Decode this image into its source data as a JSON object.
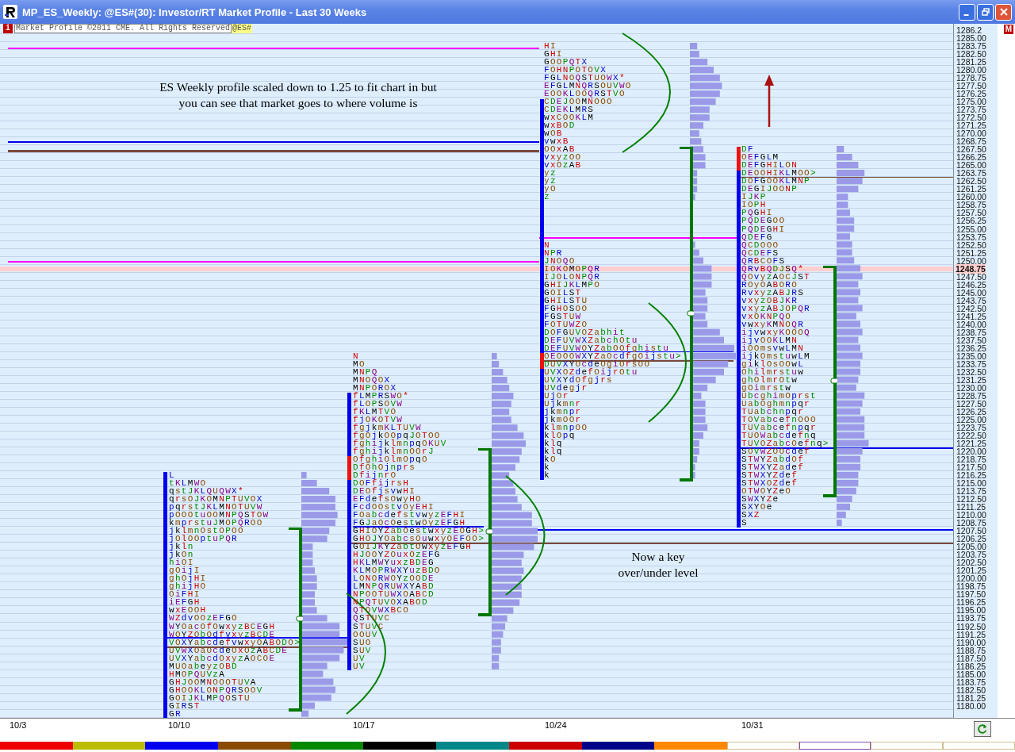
{
  "window": {
    "title": "MP_ES_Weekly: @ES#(30): Investor/RT Market Profile - Last 30 Weeks"
  },
  "info_bar": {
    "badge": "i",
    "copyright": "Market Profile ©2011 CME. All Rights Reserved",
    "symbol": "@ES#",
    "marker": "M"
  },
  "annotations": [
    {
      "text": "ES Weekly profile scaled down to 1.25 to fit chart in but you can see that market goes to where volume is"
    },
    {
      "text": "Now a key over/under level"
    }
  ],
  "profiles": [
    {
      "segments": [
        [
          "L",
          "tKLMWO",
          "qstJKLQUQWX*",
          "qrsOJKOMNPTUVOX",
          "pqrstJKLMNOTUVW",
          "pOOOtuOOMNPQSTOW",
          "kmprstuJMOPQROO",
          "jklmnOstOPOO",
          "jOlOOptuPQR",
          "jkln",
          "jkOn",
          "hiOI",
          "gOijI",
          "ghOjHI",
          "ghijHO",
          "OiFHI",
          "iEFGH",
          "wxEOOH",
          "WZdvOOzEFGO",
          "WYOacOfOwxyzBCEGH",
          "WOYZObOdfvxyzBCDE",
          "VOXYabcdefvwxyOABODO>",
          "UVWXOaOcdeOxOzABCDE",
          "UVXYabcdOxyzAOCOE",
          "MUOabeyzOBD",
          "HMOPQUVzA",
          "GHJOOMNOOOTUVA",
          "GHOOKLONPQRSOOV",
          "GOIJKLMPQOSTU",
          "GIRST",
          "GR"
        ]
      ]
    },
    {
      "segments": [
        [
          "N",
          "MO",
          "MNPQ",
          "MNOQOX",
          "MNPOROX",
          "fLMPRSWO*",
          "fLOPSOVW",
          "fKLMTVO",
          "fjOKOTVW",
          "fgjkmKLTUVW",
          "fgOjkOOpqJOTOO",
          "fghijklmnpqOKUV",
          "fghijklmnOOrJ",
          "OfghiOlmOpqO",
          "DfOhOjnprs",
          "DfijnrO",
          "DOFfijrsH",
          "DEOfjsvwHI",
          "EFdefsOwyHO",
          "FcdOOstvOyEHI",
          "FOabcdefstvwyzEFHI",
          "FGJaOcOestwOyzEFGH",
          "GHIOYZabOestwxyzEOGH>",
          "GHOJYOabcsOuwxyOEFOO>",
          "GOIJKYZabtOwxyzEFGH",
          "HJOOYZOuxOzEFG",
          "HKLMWYuxzBDEG",
          "KLMOPRWXYuzBDO",
          "LONORWOYzOODE",
          "LMNPQRUWXYABD",
          "NPOOTUWXOABCD",
          "NPQTUVOXABOD",
          "QTOVWXBCO",
          "QSTUVC",
          "STUVC",
          "OOUV",
          "SUO",
          "SUV",
          "UV",
          "UV"
        ]
      ]
    },
    {
      "segments": [
        [
          "HI",
          "GHI",
          "GOOPQTX",
          "FOHNPOTOVX",
          "FGLNOQSTUOWX*",
          "EFGLMNQRSOUVWO",
          "EOOKLOOQRSTVO",
          "CDEJOOMNOOO",
          "CDEKLMRS",
          "wxCOOKLM",
          "wxBOD",
          "wOB",
          "vwxB",
          "OOxAB",
          "vxyzOO",
          "vxOzAB",
          "yz",
          "yz",
          "yO",
          "z"
        ],
        [
          "N",
          "NPR",
          "JNOQO",
          "IOKOMOPQR",
          "IJOLONPQR",
          "GHIJKLMPO",
          "GOILST",
          "GHILSTU",
          "FGHOSOO",
          "FGSTUW",
          "FOTUWZO",
          "DOFGUVOZabhit",
          "DEFUVWXZabchOtu",
          "DEFUVWOYZabOOfghistu",
          "OEOOOWXYZaOcdfgOijstu>",
          "DUVXYOcdeOgiOrsOO",
          "UVXOZdefOijrOtu",
          "UVXYdOfgjrs",
          "UVdegjr",
          "UjOr",
          "Ujkmnr",
          "jkmnpr",
          "jkmOOr",
          "klmnpOO",
          "klOpq",
          "klq",
          "klq",
          "kO",
          "k",
          "k"
        ]
      ]
    },
    {
      "segments": [
        [
          "DF",
          "OEFGLM",
          "DEFGHILON",
          "DEOOHIKLMOO>",
          "DOFGOOKLMNP",
          "DEGIJOONP",
          "IJKP",
          "IOPH",
          "PQGHI",
          "PQDEGOO",
          "PQDEGHI",
          "QDEFG",
          "QCDOOO",
          "QCDEFS",
          "QRBCOFS",
          "QRvBQDJSQ*",
          "QOvyzAOCJST",
          "ROyOABORO",
          "RvxyzABJRS",
          "vxyzOBJKR",
          "vxyzABJOPQR",
          "vxOKNPQO",
          "vwxyKMNOQR",
          "ijvwxyKOOOQ",
          "ijvOOKLMN",
          "iOOmsvwLMN",
          "ijkOmstuwLM",
          "giklOsOOwL",
          "Ohilmrstuw",
          "ghOlmrOtw",
          "gOimrstw",
          "UbcghimOprst",
          "UabOghmnpqr",
          "TUabchnpqr",
          "TOVabcefnOOO",
          "TUVabcefnpqr",
          "TUOWabcdefnq",
          "TUVOZabcOefnq>",
          "SOVWZOOcdef",
          "STWYZabdOf",
          "STWXYZadef",
          "STWXYZdef",
          "STWXOZdef",
          "OTWOYZeO",
          "SWXYZe",
          "SXYOe",
          "SXZ",
          "S"
        ]
      ]
    }
  ],
  "price_axis": {
    "current": "1248.75",
    "labels": [
      "1286.2",
      "1285.00",
      "1283.75",
      "1282.50",
      "1281.25",
      "1280.00",
      "1278.75",
      "1277.50",
      "1276.25",
      "1275.00",
      "1273.75",
      "1272.50",
      "1271.25",
      "1270.00",
      "1268.75",
      "1267.50",
      "1266.25",
      "1265.00",
      "1263.75",
      "1262.50",
      "1261.25",
      "1260.00",
      "1258.75",
      "1257.50",
      "1256.25",
      "1255.00",
      "1253.75",
      "1252.50",
      "1251.25",
      "1250.00",
      "1247.50",
      "1246.25",
      "1245.00",
      "1243.75",
      "1242.50",
      "1241.25",
      "1240.00",
      "1238.75",
      "1237.50",
      "1236.25",
      "1235.00",
      "1233.75",
      "1232.50",
      "1231.25",
      "1230.00",
      "1228.75",
      "1227.50",
      "1226.25",
      "1225.00",
      "1223.75",
      "1222.50",
      "1221.25",
      "1220.00",
      "1218.75",
      "1217.50",
      "1216.25",
      "1215.00",
      "1213.75",
      "1212.50",
      "1211.25",
      "1210.00",
      "1208.75",
      "1207.50",
      "1206.25",
      "1205.00",
      "1203.75",
      "1202.50",
      "1201.25",
      "1200.00",
      "1198.75",
      "1197.50",
      "1196.25",
      "1195.00",
      "1193.75",
      "1192.50",
      "1191.25",
      "1190.00",
      "1188.75",
      "1187.50",
      "1186.25",
      "1185.00",
      "1183.75",
      "1182.50",
      "1181.25",
      "1180.00"
    ]
  },
  "dates": [
    "10/3",
    "10/10",
    "10/17",
    "10/24",
    "10/31"
  ]
}
